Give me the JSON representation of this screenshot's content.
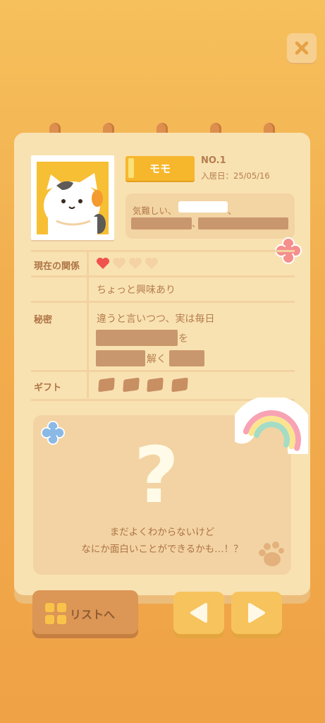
{
  "close_button": {
    "icon": "close-icon"
  },
  "profile": {
    "name": "モモ",
    "number": "NO.1",
    "move_in_label": "入居日：25/05/16",
    "traits_prefix": "気難しい、",
    "traits_sep1": "、",
    "traits_sep2": "、"
  },
  "table": {
    "relation_label": "現在の関係",
    "relation_hearts": {
      "filled": 1,
      "total": 4
    },
    "relation_status": "ちょっと興味あり",
    "secret_label": "秘密",
    "secret_line1": "違うと言いつつ、実は毎日",
    "secret_line2_suffix": "を",
    "secret_line3_mid": "解く",
    "gift_label": "ギフト"
  },
  "mystery": {
    "symbol": "?",
    "line1": "まだよくわからないけど",
    "line2": "なにか面白いことができるかも…！？"
  },
  "footer": {
    "list_button": "リストへ",
    "prev_icon": "triangle-left-icon",
    "next_icon": "triangle-right-icon"
  },
  "colors": {
    "accent": "#f7b72d",
    "heart": "#f0524d",
    "card": "#f9e2b2"
  }
}
